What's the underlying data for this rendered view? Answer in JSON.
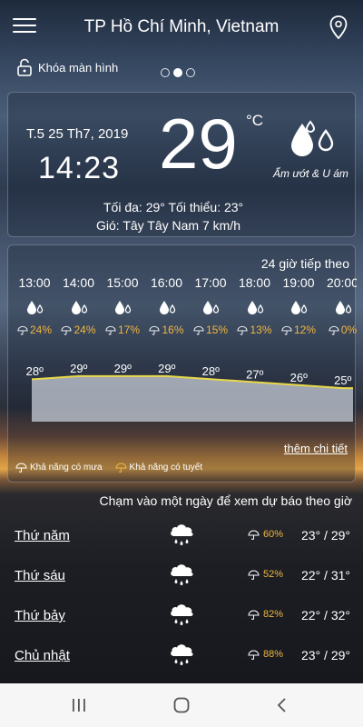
{
  "header": {
    "city": "TP Hồ Chí Minh, Vietnam"
  },
  "lock": {
    "label": "Khóa màn hình"
  },
  "current": {
    "date": "T.5 25 Th7, 2019",
    "time": "14:23",
    "temp": "29",
    "unit": "°C",
    "condition": "Ẩm ướt & U ám",
    "minmax": "Tối đa: 29°  Tối thiểu: 23°",
    "wind": "Gió: Tây Tây Nam 7 km/h"
  },
  "hourly": {
    "title": "24 giờ tiếp theo",
    "items": [
      {
        "time": "13:00",
        "rain": "24%",
        "temp": "28º",
        "temp_value": 28
      },
      {
        "time": "14:00",
        "rain": "24%",
        "temp": "29º",
        "temp_value": 29
      },
      {
        "time": "15:00",
        "rain": "17%",
        "temp": "29º",
        "temp_value": 29
      },
      {
        "time": "16:00",
        "rain": "16%",
        "temp": "29º",
        "temp_value": 29
      },
      {
        "time": "17:00",
        "rain": "15%",
        "temp": "28º",
        "temp_value": 28
      },
      {
        "time": "18:00",
        "rain": "13%",
        "temp": "27º",
        "temp_value": 27
      },
      {
        "time": "19:00",
        "rain": "12%",
        "temp": "26º",
        "temp_value": 26
      },
      {
        "time": "20:00",
        "rain": "0%",
        "temp": "25º",
        "temp_value": 25
      }
    ],
    "more": "thêm chi tiết",
    "legend_rain": "Khả năng có mưa",
    "legend_snow": "Khả năng có tuyết"
  },
  "daily": {
    "hint": "Chạm vào một ngày để xem dự báo theo giờ",
    "days": [
      {
        "name": "Thứ năm",
        "rain": "60%",
        "range": "23° / 29°"
      },
      {
        "name": "Thứ sáu",
        "rain": "52%",
        "range": "22° / 31°"
      },
      {
        "name": "Thứ bảy",
        "rain": "82%",
        "range": "22° / 32°"
      },
      {
        "name": "Chủ nhật",
        "rain": "88%",
        "range": "23° / 29°"
      }
    ]
  },
  "colors": {
    "accent": "#f2b640",
    "graph_line": "#e8d84a"
  }
}
